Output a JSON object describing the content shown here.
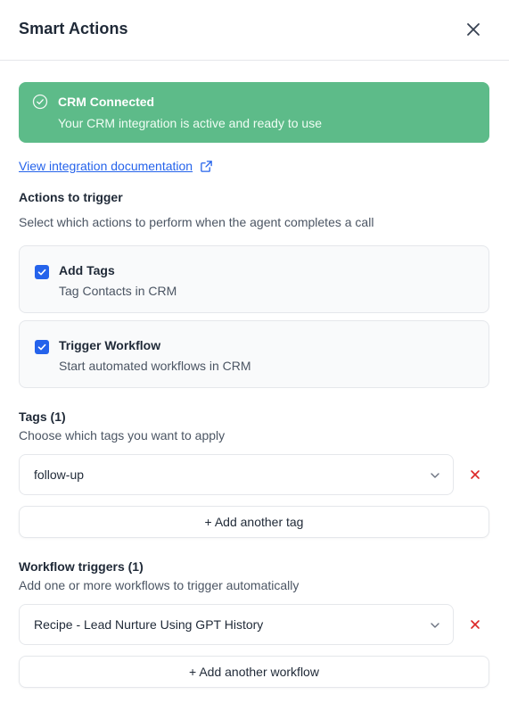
{
  "header": {
    "title": "Smart Actions",
    "close_icon": "close-icon"
  },
  "banner": {
    "title": "CRM Connected",
    "subtitle": "Your CRM integration is active and ready to use",
    "icon": "check-circle-icon",
    "color": "#5dbb89"
  },
  "doc_link": {
    "label": "View integration documentation",
    "icon": "external-link-icon"
  },
  "actions": {
    "heading": "Actions to trigger",
    "subtitle": "Select which actions to perform when the agent completes a call",
    "items": [
      {
        "title": "Add Tags",
        "description": "Tag Contacts in CRM",
        "checked": true
      },
      {
        "title": "Trigger Workflow",
        "description": "Start automated workflows in CRM",
        "checked": true
      }
    ]
  },
  "tags": {
    "heading": "Tags (1)",
    "subtitle": "Choose which tags you want to apply",
    "selected": [
      "follow-up"
    ],
    "add_label": "+ Add another tag"
  },
  "workflows": {
    "heading": "Workflow triggers (1)",
    "subtitle": "Add one or more workflows to trigger automatically",
    "selected": [
      "Recipe - Lead Nurture Using GPT History"
    ],
    "add_label": "+ Add another workflow"
  },
  "colors": {
    "accent": "#2563eb",
    "success": "#5dbb89",
    "danger": "#dc2626"
  }
}
